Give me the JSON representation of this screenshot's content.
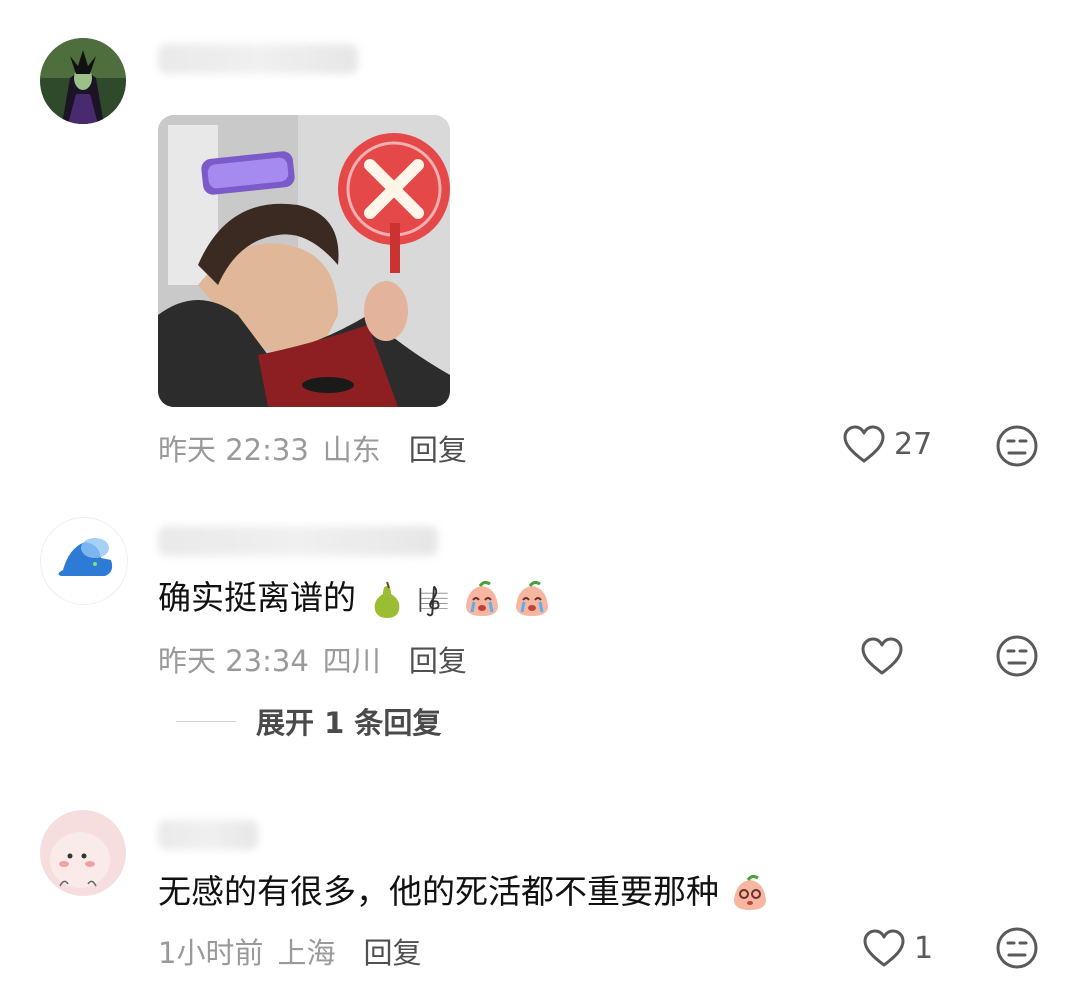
{
  "comments": [
    {
      "timestamp": "昨天 22:33",
      "location": "山东",
      "reply_label": "回复",
      "like_count": "27"
    },
    {
      "text": "确实挺离谱的",
      "timestamp": "昨天 23:34",
      "location": "四川",
      "reply_label": "回复",
      "like_count": "",
      "expand_label": "展开 1 条回复"
    },
    {
      "text": "无感的有很多，他的死活都不重要那种",
      "timestamp": "1小时前",
      "location": "上海",
      "reply_label": "回复",
      "like_count": "1"
    }
  ],
  "icons": {
    "like": "heart-outline-icon",
    "dislike": "meh-face-icon",
    "pear": "pear-emoji",
    "music": "treble-clef-emoji",
    "crying_peach": "crying-peach-emoji",
    "shy_peach": "shy-peach-emoji"
  },
  "colors": {
    "text": "#111111",
    "meta": "#9a9a9a",
    "reply": "#505050",
    "icon": "#5a5a5a"
  }
}
